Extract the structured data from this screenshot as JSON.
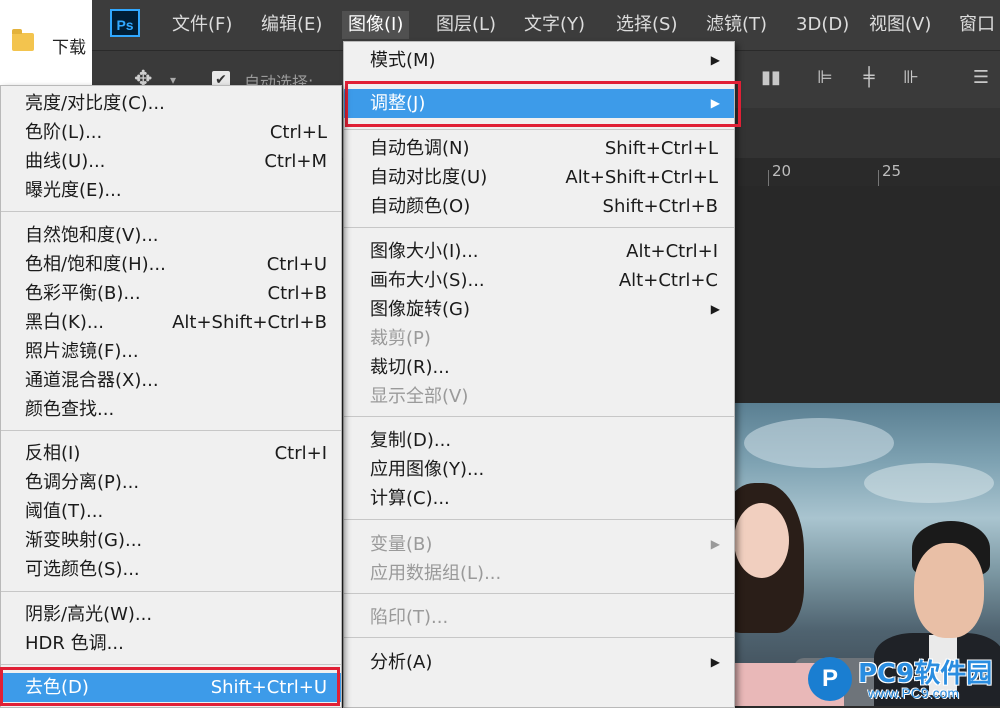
{
  "explorer": {
    "item_label": "下载"
  },
  "app": {
    "logo": "Ps",
    "menubar": [
      {
        "label": "文件(F)"
      },
      {
        "label": "编辑(E)"
      },
      {
        "label": "图像(I)"
      },
      {
        "label": "图层(L)"
      },
      {
        "label": "文字(Y)"
      },
      {
        "label": "选择(S)"
      },
      {
        "label": "滤镜(T)"
      },
      {
        "label": "3D(D)"
      },
      {
        "label": "视图(V)"
      },
      {
        "label": "窗口"
      }
    ],
    "active_menu": "图像(I)",
    "options_bar": {
      "move_icon": "move-icon",
      "autoselect_label": "自动选择:",
      "autoselect_checked": true
    },
    "ruler": {
      "labels": [
        "20",
        "25"
      ]
    }
  },
  "image_menu": {
    "items": [
      {
        "label": "模式(M)",
        "shortcut": "",
        "submenu": true
      },
      {
        "label": "调整(J)",
        "shortcut": "",
        "submenu": true,
        "highlighted": true
      },
      {
        "label": "自动色调(N)",
        "shortcut": "Shift+Ctrl+L"
      },
      {
        "label": "自动对比度(U)",
        "shortcut": "Alt+Shift+Ctrl+L"
      },
      {
        "label": "自动颜色(O)",
        "shortcut": "Shift+Ctrl+B"
      },
      {
        "label": "图像大小(I)...",
        "shortcut": "Alt+Ctrl+I"
      },
      {
        "label": "画布大小(S)...",
        "shortcut": "Alt+Ctrl+C"
      },
      {
        "label": "图像旋转(G)",
        "shortcut": "",
        "submenu": true
      },
      {
        "label": "裁剪(P)",
        "shortcut": "",
        "disabled": true
      },
      {
        "label": "裁切(R)...",
        "shortcut": ""
      },
      {
        "label": "显示全部(V)",
        "shortcut": "",
        "disabled": true
      },
      {
        "label": "复制(D)...",
        "shortcut": ""
      },
      {
        "label": "应用图像(Y)...",
        "shortcut": ""
      },
      {
        "label": "计算(C)...",
        "shortcut": ""
      },
      {
        "label": "变量(B)",
        "shortcut": "",
        "submenu": true,
        "disabled": true
      },
      {
        "label": "应用数据组(L)...",
        "shortcut": "",
        "disabled": true
      },
      {
        "label": "陷印(T)...",
        "shortcut": "",
        "disabled": true
      },
      {
        "label": "分析(A)",
        "shortcut": "",
        "submenu": true
      }
    ]
  },
  "adjust_menu": {
    "items": [
      {
        "label": "亮度/对比度(C)...",
        "shortcut": ""
      },
      {
        "label": "色阶(L)...",
        "shortcut": "Ctrl+L"
      },
      {
        "label": "曲线(U)...",
        "shortcut": "Ctrl+M"
      },
      {
        "label": "曝光度(E)...",
        "shortcut": ""
      },
      {
        "label": "自然饱和度(V)...",
        "shortcut": ""
      },
      {
        "label": "色相/饱和度(H)...",
        "shortcut": "Ctrl+U"
      },
      {
        "label": "色彩平衡(B)...",
        "shortcut": "Ctrl+B"
      },
      {
        "label": "黑白(K)...",
        "shortcut": "Alt+Shift+Ctrl+B"
      },
      {
        "label": "照片滤镜(F)...",
        "shortcut": ""
      },
      {
        "label": "通道混合器(X)...",
        "shortcut": ""
      },
      {
        "label": "颜色查找...",
        "shortcut": ""
      },
      {
        "label": "反相(I)",
        "shortcut": "Ctrl+I"
      },
      {
        "label": "色调分离(P)...",
        "shortcut": ""
      },
      {
        "label": "阈值(T)...",
        "shortcut": ""
      },
      {
        "label": "渐变映射(G)...",
        "shortcut": ""
      },
      {
        "label": "可选颜色(S)...",
        "shortcut": ""
      },
      {
        "label": "阴影/高光(W)...",
        "shortcut": ""
      },
      {
        "label": "HDR 色调...",
        "shortcut": ""
      },
      {
        "label": "去色(D)",
        "shortcut": "Shift+Ctrl+U",
        "highlighted": true
      }
    ]
  },
  "watermark": {
    "logo": "P",
    "text": "PC9软件园",
    "url": "www.PC9.com"
  },
  "colors": {
    "highlight": "#3d9be9",
    "annotation_red": "#e02035",
    "menu_bg": "#f0f0f0",
    "ps_blue": "#31a8ff"
  }
}
